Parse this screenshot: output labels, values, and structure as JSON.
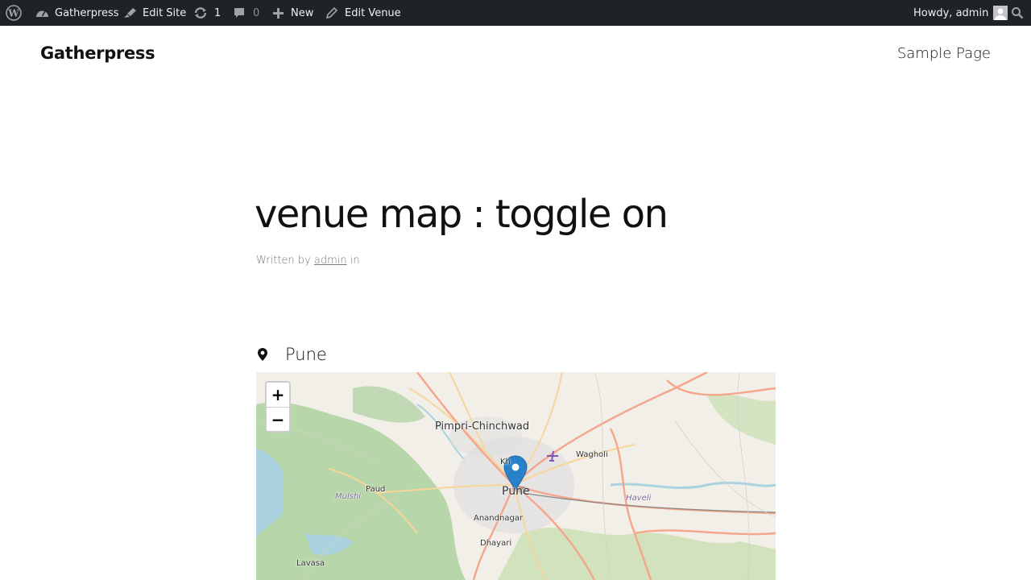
{
  "admin_bar": {
    "site_name": "Gatherpress",
    "edit_site": "Edit Site",
    "updates_count": "1",
    "comments_count": "0",
    "new_label": "New",
    "edit_venue": "Edit Venue",
    "howdy": "Howdy, admin"
  },
  "site": {
    "title": "Gatherpress",
    "nav": {
      "sample_page": "Sample Page"
    }
  },
  "post": {
    "title": "venue map : toggle on",
    "byline_prefix": "Written by",
    "author": "admin",
    "byline_suffix": "in"
  },
  "venue": {
    "name": "Pune",
    "icon": "map-pin-icon"
  },
  "map": {
    "zoom_in": "+",
    "zoom_out": "−",
    "labels": {
      "pimpri": "Pimpri-Chinchwad",
      "wagholi": "Wagholi",
      "paud": "Paud",
      "mulshi": "Mulshi",
      "pune": "Pune",
      "haveli": "Haveli",
      "anandnagar": "Anandnagar",
      "dhayari": "Dhayari",
      "lavasa": "Lavasa",
      "khadki": "Kh"
    },
    "colors": {
      "land": "#f2efe9",
      "forest": "#add19e",
      "water": "#aad3df",
      "primary_road": "#f4a58a",
      "secondary_road": "#f7d59b",
      "marker": "#2a81cb"
    }
  }
}
